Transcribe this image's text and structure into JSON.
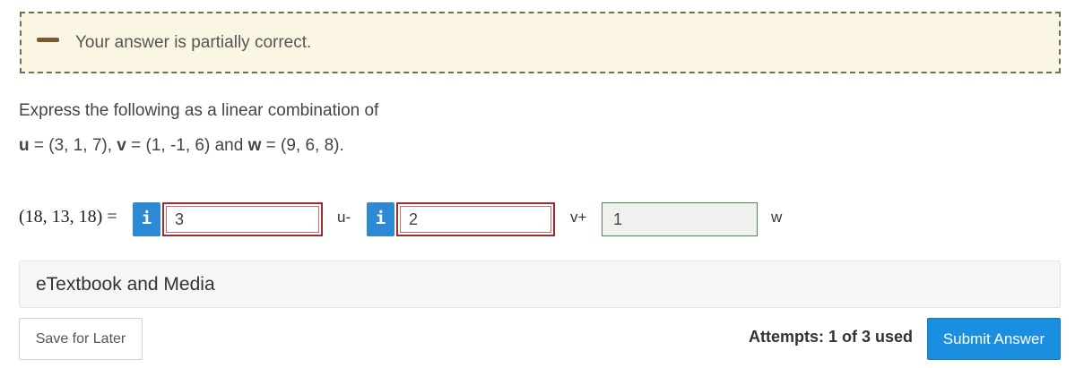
{
  "feedback": {
    "status": "partially-correct",
    "icon": "minus-icon",
    "message": "Your answer is partially correct.",
    "accent_color": "#fbf6e3"
  },
  "question": {
    "prompt": "Express the following as a linear combination of",
    "u_label": "u",
    "u_value": " = (3, 1, 7), ",
    "v_label": "v",
    "v_value": " = (1, -1, 6) and ",
    "w_label": "w",
    "w_value": " = (9, 6, 8)."
  },
  "equation": {
    "lhs": "(18, 13, 18) =",
    "info_label": "i",
    "inputs": [
      {
        "value": "3",
        "status": "incorrect"
      },
      {
        "value": "2",
        "status": "incorrect"
      },
      {
        "value": "1",
        "status": "correct"
      }
    ],
    "op_u": "u-",
    "op_v": "v+",
    "op_w": "w"
  },
  "resources": {
    "etextbook_label": "eTextbook and Media"
  },
  "footer": {
    "save_label": "Save for Later",
    "attempts_text": "Attempts: 1 of 3 used",
    "submit_label": "Submit Answer",
    "submit_color": "#1a8ee0"
  }
}
